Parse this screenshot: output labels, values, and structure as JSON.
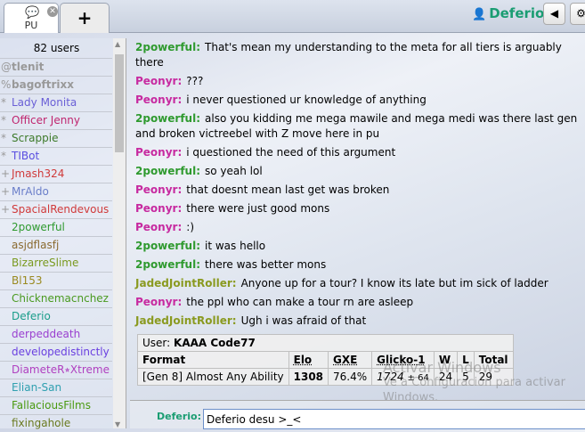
{
  "tabs": [
    {
      "label": "PU",
      "icon": "chat-bubble-icon"
    },
    {
      "label": "+"
    }
  ],
  "header": {
    "username": "Deferio",
    "sound_icon": "◀",
    "settings_icon": "⚙"
  },
  "userlist": {
    "count": "82 users",
    "users": [
      {
        "g": "@",
        "n": "tlenit",
        "c": "#888",
        "b": true
      },
      {
        "g": "%",
        "n": "bagoftrixx",
        "c": "#888",
        "b": true
      },
      {
        "g": "*",
        "n": "Lady Monita",
        "c": "#6a5fd6"
      },
      {
        "g": "*",
        "n": "Officer Jenny",
        "c": "#c0256e"
      },
      {
        "g": "*",
        "n": "Scrappie",
        "c": "#3d7a2a"
      },
      {
        "g": "*",
        "n": "TIBot",
        "c": "#5a4fe0"
      },
      {
        "g": "+",
        "n": "Jmash324",
        "c": "#d03a3a"
      },
      {
        "g": "+",
        "n": "MrAldo",
        "c": "#6a7ec9"
      },
      {
        "g": "+",
        "n": "SpacialRendevous",
        "c": "#d03a3a"
      },
      {
        "g": "",
        "n": "2powerful",
        "c": "#2f9a2f"
      },
      {
        "g": "",
        "n": "asjdflasfj",
        "c": "#8a6a30"
      },
      {
        "g": "",
        "n": "BizarreSlime",
        "c": "#7a9a20"
      },
      {
        "g": "",
        "n": "Bl153",
        "c": "#9a8a20"
      },
      {
        "g": "",
        "n": "Chicknemacnchez",
        "c": "#4a9a20"
      },
      {
        "g": "",
        "n": "Deferio",
        "c": "#1a9d8a"
      },
      {
        "g": "",
        "n": "derpeddeath",
        "c": "#9a40d0"
      },
      {
        "g": "",
        "n": "developedistinctly",
        "c": "#6a40e0"
      },
      {
        "g": "",
        "n": "DiameteR⭒Xtreme",
        "c": "#b040c0"
      },
      {
        "g": "",
        "n": "Elian-San",
        "c": "#30a0b0"
      },
      {
        "g": "",
        "n": "FallaciousFilms",
        "c": "#4a9a10"
      },
      {
        "g": "",
        "n": "fixingahole",
        "c": "#6a7a20"
      }
    ]
  },
  "messages": [
    {
      "u": "2powerful",
      "c": "#2f9a2f",
      "t": "That's mean my understanding to the meta for all tiers is arguably there"
    },
    {
      "u": "Peonyr",
      "c": "#c72aa0",
      "t": "???"
    },
    {
      "u": "Peonyr",
      "c": "#c72aa0",
      "t": "i never questioned ur knowledge of anything"
    },
    {
      "u": "2powerful",
      "c": "#2f9a2f",
      "t": "also you kidding me mega mawile and mega medi was there last gen and broken victreebel with Z move here in pu"
    },
    {
      "u": "Peonyr",
      "c": "#c72aa0",
      "t": "i questioned the need of this argument"
    },
    {
      "u": "2powerful",
      "c": "#2f9a2f",
      "t": "so yeah lol"
    },
    {
      "u": "Peonyr",
      "c": "#c72aa0",
      "t": "that doesnt mean last get was broken"
    },
    {
      "u": "Peonyr",
      "c": "#c72aa0",
      "t": "there were just good mons"
    },
    {
      "u": "Peonyr",
      "c": "#c72aa0",
      "t": ":)"
    },
    {
      "u": "2powerful",
      "c": "#2f9a2f",
      "t": "it was hello"
    },
    {
      "u": "2powerful",
      "c": "#2f9a2f",
      "t": "there was better mons"
    },
    {
      "u": "JadedJointRoller",
      "c": "#8a9a20",
      "t": "Anyone up for a tour? I know its late but im sick of ladder"
    },
    {
      "u": "Peonyr",
      "c": "#c72aa0",
      "t": "the ppl who can make a tour rn are asleep"
    },
    {
      "u": "JadedJointRoller",
      "c": "#8a9a20",
      "t": "Ugh i was afraid of that"
    }
  ],
  "rank": {
    "user_label": "User:",
    "user": "KAAA Code77",
    "headers": [
      "Format",
      "Elo",
      "GXE",
      "Glicko-1",
      "W",
      "L",
      "Total"
    ],
    "row": {
      "format": "[Gen 8] Almost Any Ability",
      "elo": "1308",
      "gxe": "76.4%",
      "glicko": "1724",
      "glicko_dev": "± 64",
      "w": "24",
      "l": "5",
      "total": "29"
    }
  },
  "input": {
    "name": "Deferio:",
    "value": "Deferio desu >_<"
  },
  "watermark": {
    "line1": "Activar Windows",
    "line2": "Ve a Configuración para activar Windows."
  }
}
